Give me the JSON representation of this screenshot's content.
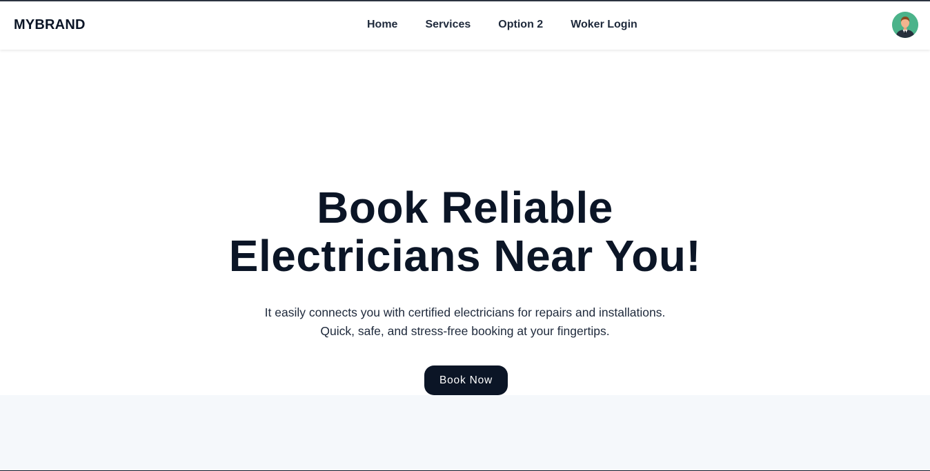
{
  "navbar": {
    "brand": "MYBRAND",
    "links": [
      {
        "label": "Home"
      },
      {
        "label": "Services"
      },
      {
        "label": "Option 2"
      },
      {
        "label": "Woker Login"
      }
    ],
    "avatar_icon": "user-avatar-icon"
  },
  "hero": {
    "title_line1": "Book Reliable",
    "title_line2": "Electricians Near You!",
    "subtitle_line1": "It easily connects you with certified electricians for repairs and installations.",
    "subtitle_line2": "Quick, safe, and stress-free booking at your fingertips.",
    "cta_label": "Book Now"
  },
  "colors": {
    "primary": "#0b1526",
    "background": "#ffffff",
    "section_background": "#f5f8fb",
    "avatar_background": "#4bb38a"
  }
}
